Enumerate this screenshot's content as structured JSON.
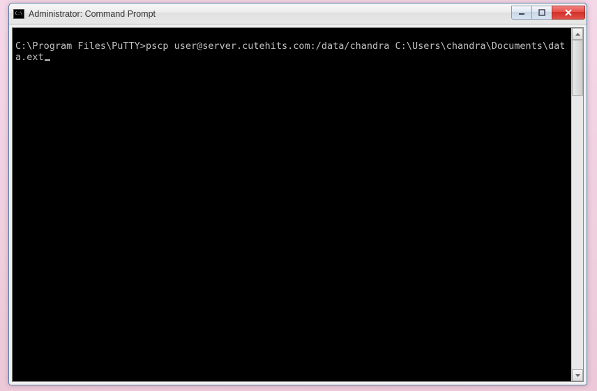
{
  "window": {
    "title": "Administrator: Command Prompt"
  },
  "console": {
    "prompt": "C:\\Program Files\\PuTTY>",
    "command": "pscp user@server.cutehits.com:/data/chandra C:\\Users\\chandra\\Documents\\data.ext"
  }
}
